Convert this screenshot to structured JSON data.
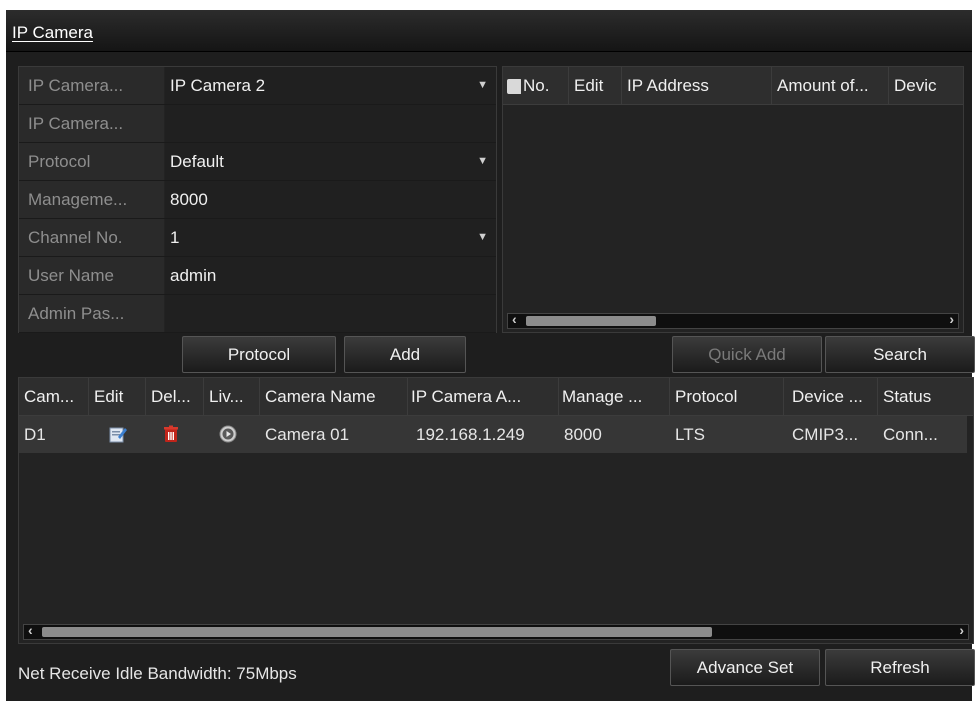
{
  "window": {
    "title": "IP Camera"
  },
  "form": {
    "rows": [
      {
        "label": "IP Camera...",
        "value": "IP Camera 2",
        "dropdown": true
      },
      {
        "label": "IP Camera...",
        "value": "",
        "dropdown": false
      },
      {
        "label": "Protocol",
        "value": "Default",
        "dropdown": true
      },
      {
        "label": "Manageme...",
        "value": "8000",
        "dropdown": false
      },
      {
        "label": "Channel No.",
        "value": "1",
        "dropdown": true
      },
      {
        "label": "User Name",
        "value": "admin",
        "dropdown": false
      },
      {
        "label": "Admin Pas...",
        "value": "",
        "dropdown": false
      }
    ],
    "protocol_button": "Protocol",
    "add_button": "Add"
  },
  "search_panel": {
    "columns": [
      "No.",
      "Edit",
      "IP Address",
      "Amount of...",
      "Devic"
    ],
    "quick_add_button": "Quick Add",
    "search_button": "Search"
  },
  "camera_table": {
    "columns": [
      "Cam...",
      "Edit",
      "Del...",
      "Liv...",
      "Camera Name",
      "IP Camera A...",
      "Manage ...",
      "Protocol",
      "Device ...",
      "Status"
    ],
    "rows": [
      {
        "cam": "D1",
        "camera_name": "Camera 01",
        "ip": "192.168.1.249",
        "manage_port": "8000",
        "protocol": "LTS",
        "device": "CMIP3...",
        "status": "Conn..."
      }
    ]
  },
  "footer": {
    "bandwidth": "Net Receive Idle Bandwidth: 75Mbps",
    "advance_set_button": "Advance Set",
    "refresh_button": "Refresh"
  },
  "colors": {
    "background": "#1e1e1e",
    "delete_icon": "#c0241a",
    "edit_icon": "#3b7fd0"
  }
}
